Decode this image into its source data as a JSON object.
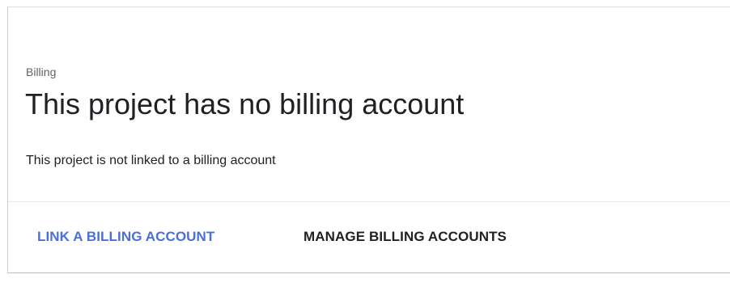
{
  "header": {
    "eyebrow": "Billing",
    "title": "This project has no billing account",
    "subtitle": "This project is not linked to a billing account"
  },
  "actions": {
    "link_label": "LINK A BILLING ACCOUNT",
    "manage_label": "MANAGE BILLING ACCOUNTS"
  },
  "colors": {
    "primary_action": "#4a6fd8",
    "text": "#202124",
    "secondary_text": "#5f6368"
  }
}
